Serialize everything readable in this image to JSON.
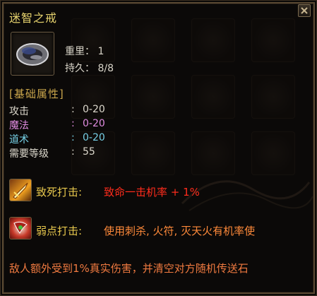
{
  "item": {
    "name": "迷智之戒",
    "weight_label": "重里：",
    "weight_value": "1",
    "durability_label": "持久：",
    "durability_value": "8/8"
  },
  "section_title": "[基础属性]",
  "attributes": [
    {
      "label": "攻击",
      "value": "0-20"
    },
    {
      "label": "魔法",
      "value": "0-20"
    },
    {
      "label": "道术",
      "value": "0-20"
    },
    {
      "label": "需要等级",
      "value": "55"
    }
  ],
  "separator": ":",
  "skills": [
    {
      "name": "致死打击:",
      "desc": "致命一击机率 + 1%"
    },
    {
      "name": "弱点打击:",
      "desc": "使用刺杀, 火符, 灭天火有机率使"
    }
  ],
  "footer_text": "敌人额外受到1%真实伤害，并清空对方随机传送石",
  "colors": {
    "title": "#e7d36e",
    "section": "#c9a54b",
    "magic": "#e08ce0",
    "tao": "#76d0e6",
    "skill_name": "#e8c84d",
    "skill1_desc": "#ff2c1c",
    "skill2_desc": "#ff8a3a"
  },
  "icons": {
    "item": "ring-icon",
    "skill1": "sword-strike-icon",
    "skill2": "weak-point-icon",
    "close": "close-icon"
  }
}
